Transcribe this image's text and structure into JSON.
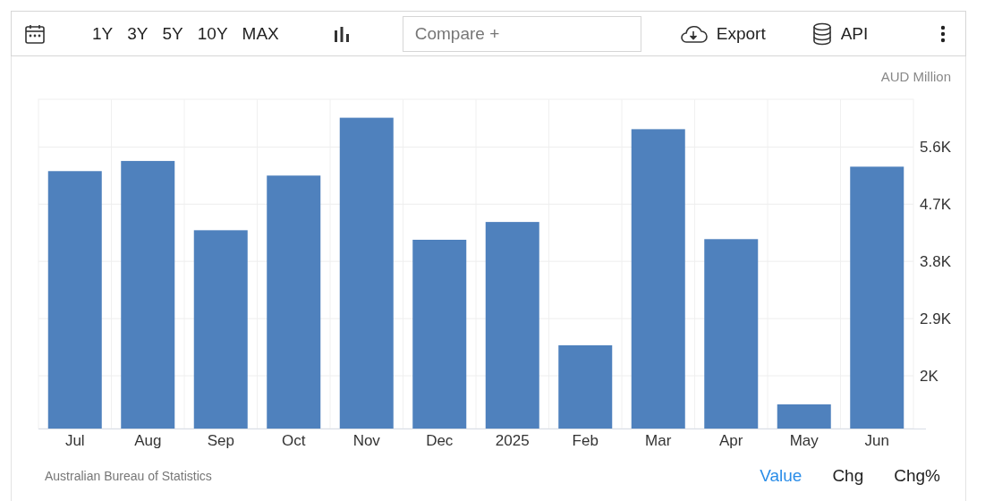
{
  "toolbar": {
    "ranges": [
      {
        "label": "1Y"
      },
      {
        "label": "3Y"
      },
      {
        "label": "5Y"
      },
      {
        "label": "10Y"
      },
      {
        "label": "MAX"
      }
    ],
    "compare": {
      "placeholder": "Compare +"
    },
    "actions": [
      {
        "kind": "export",
        "label": "Export"
      },
      {
        "kind": "api",
        "label": "API"
      }
    ]
  },
  "unit": "AUD Million",
  "chart_data": {
    "type": "bar",
    "categories": [
      "Jul",
      "Aug",
      "Sep",
      "Oct",
      "Nov",
      "Dec",
      "2025",
      "Feb",
      "Mar",
      "Apr",
      "May",
      "Jun"
    ],
    "grid": true,
    "series": [
      {
        "color": "#4f81bd",
        "values": [
          5.22,
          5.38,
          4.29,
          5.15,
          6.06,
          4.14,
          4.42,
          2.48,
          5.88,
          4.15,
          1.55,
          5.29
        ]
      }
    ],
    "ylim": [
      1.17,
      6.35
    ],
    "yticks": [
      {
        "value": 2,
        "label": "2K"
      },
      {
        "value": 2.9,
        "label": "2.9K"
      },
      {
        "value": 3.8,
        "label": "3.8K"
      },
      {
        "value": 4.7,
        "label": "4.7K"
      },
      {
        "value": 5.6,
        "label": "5.6K"
      }
    ]
  },
  "source": "Australian Bureau of Statistics",
  "views": [
    {
      "label": "Value",
      "selected": true
    },
    {
      "label": "Chg",
      "selected": false
    },
    {
      "label": "Chg%",
      "selected": false
    }
  ]
}
